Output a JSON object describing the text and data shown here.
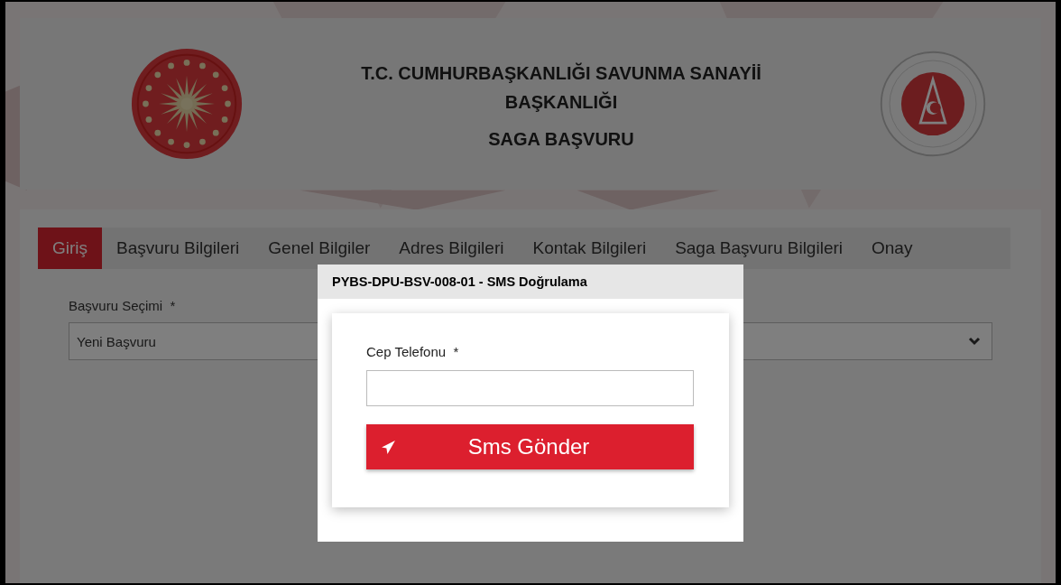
{
  "header": {
    "title": "T.C. CUMHURBAŞKANLIĞI SAVUNMA SANAYİİ BAŞKANLIĞI",
    "subtitle": "SAGA BAŞVURU"
  },
  "tabs": [
    {
      "label": "Giriş",
      "selected": true
    },
    {
      "label": "Başvuru Bilgileri",
      "selected": false
    },
    {
      "label": "Genel Bilgiler",
      "selected": false
    },
    {
      "label": "Adres Bilgileri",
      "selected": false
    },
    {
      "label": "Kontak Bilgileri",
      "selected": false
    },
    {
      "label": "Saga Başvuru Bilgileri",
      "selected": false
    },
    {
      "label": "Onay",
      "selected": false
    }
  ],
  "form": {
    "label": "Başvuru Seçimi",
    "required_mark": "*",
    "value": "Yeni Başvuru"
  },
  "dialog": {
    "title": "PYBS-DPU-BSV-008-01 - SMS Doğrulama",
    "field": {
      "label": "Cep Telefonu",
      "required_mark": "*"
    },
    "button": "Sms Gönder"
  }
}
